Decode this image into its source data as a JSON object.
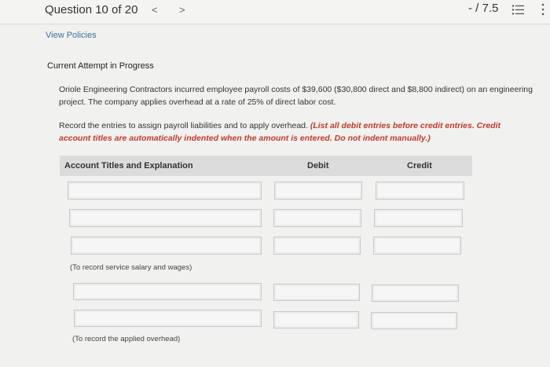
{
  "header": {
    "question_title": "Question 10 of 20",
    "prev_glyph": "<",
    "next_glyph": ">",
    "score": "- / 7.5",
    "list_icon": "list-icon",
    "more_icon": "more-vertical-icon"
  },
  "links": {
    "view_policies": "View Policies"
  },
  "status": {
    "attempt": "Current Attempt in Progress"
  },
  "problem": {
    "text": "Oriole Engineering Contractors incurred employee payroll costs of $39,600 ($30,800 direct and $8,800 indirect) on an engineering project. The company applies overhead at a rate of 25% of direct labor cost."
  },
  "instructions": {
    "text": "Record the entries to assign payroll liabilities and to apply overhead. ",
    "emphasis": "(List all debit entries before credit entries. Credit account titles are automatically indented when the amount is entered. Do not indent manually.)"
  },
  "table": {
    "headers": {
      "account": "Account Titles and Explanation",
      "debit": "Debit",
      "credit": "Credit"
    },
    "entry1": {
      "rows": [
        {
          "account": "",
          "debit": "",
          "credit": ""
        },
        {
          "account": "",
          "debit": "",
          "credit": ""
        },
        {
          "account": "",
          "debit": "",
          "credit": ""
        }
      ],
      "note": "(To record service salary and wages)"
    },
    "entry2": {
      "rows": [
        {
          "account": "",
          "debit": "",
          "credit": ""
        },
        {
          "account": "",
          "debit": "",
          "credit": ""
        }
      ],
      "note": "(To record the applied overhead)"
    }
  }
}
